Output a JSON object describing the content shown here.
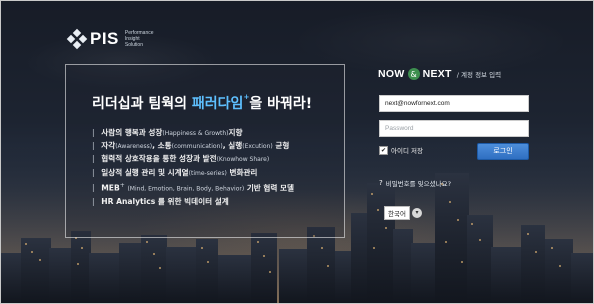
{
  "logo": {
    "name": "PIS",
    "sub_lines": [
      "Performance",
      "Insight",
      "Solution"
    ]
  },
  "panel": {
    "headline_pre": "리더십과 팀웍의 ",
    "headline_accent": "패러다임",
    "headline_mark": "+",
    "headline_post": "을 바꿔라!",
    "bullets": [
      {
        "main": "사람의 행복과 성장",
        "sub": "(Happiness & Growth)",
        "tail": "지향"
      },
      {
        "main": "자각",
        "sub": "(Awareness)",
        "tail": ", 소통",
        "sub2": "(communication)",
        "tail2": ", 실행",
        "sub3": "(Excution)",
        "tail3": " 균형"
      },
      {
        "main": "협력적 상호작용을 통한 성장과 발전",
        "sub": "(Knowhow Share)",
        "tail": ""
      },
      {
        "main": "일상적 실행 관리 및 시계열",
        "sub": "(time-series)",
        "tail": " 변화관리"
      },
      {
        "main": "MEB",
        "sup": "+",
        "sub": "(Mind, Emotion, Brain, Body, Behavior)",
        "tail": " 기반 협력 모델"
      },
      {
        "main": "HR Analytics 를 위한 빅데이터 설계",
        "sub": "",
        "tail": ""
      }
    ]
  },
  "login": {
    "brand_now": "NOW",
    "brand_amp": "&",
    "brand_next": "NEXT",
    "brand_tag": "/ 계정 정보 입력",
    "email_value": "next@nowfornext.com",
    "password_placeholder": "Password",
    "save_label": "아이디 저장",
    "save_checked": "✔",
    "login_button": "로그인",
    "forgot_label": "비밀번호를 잊으셨나요?",
    "language_value": "한국어"
  },
  "colors": {
    "accent_blue": "#5ec0ff",
    "button_blue": "#2f6fc1",
    "brand_green": "#3d8f4f"
  },
  "icons": {
    "forgot": "question-circle-icon",
    "language_dropdown": "chevron-down-icon"
  }
}
